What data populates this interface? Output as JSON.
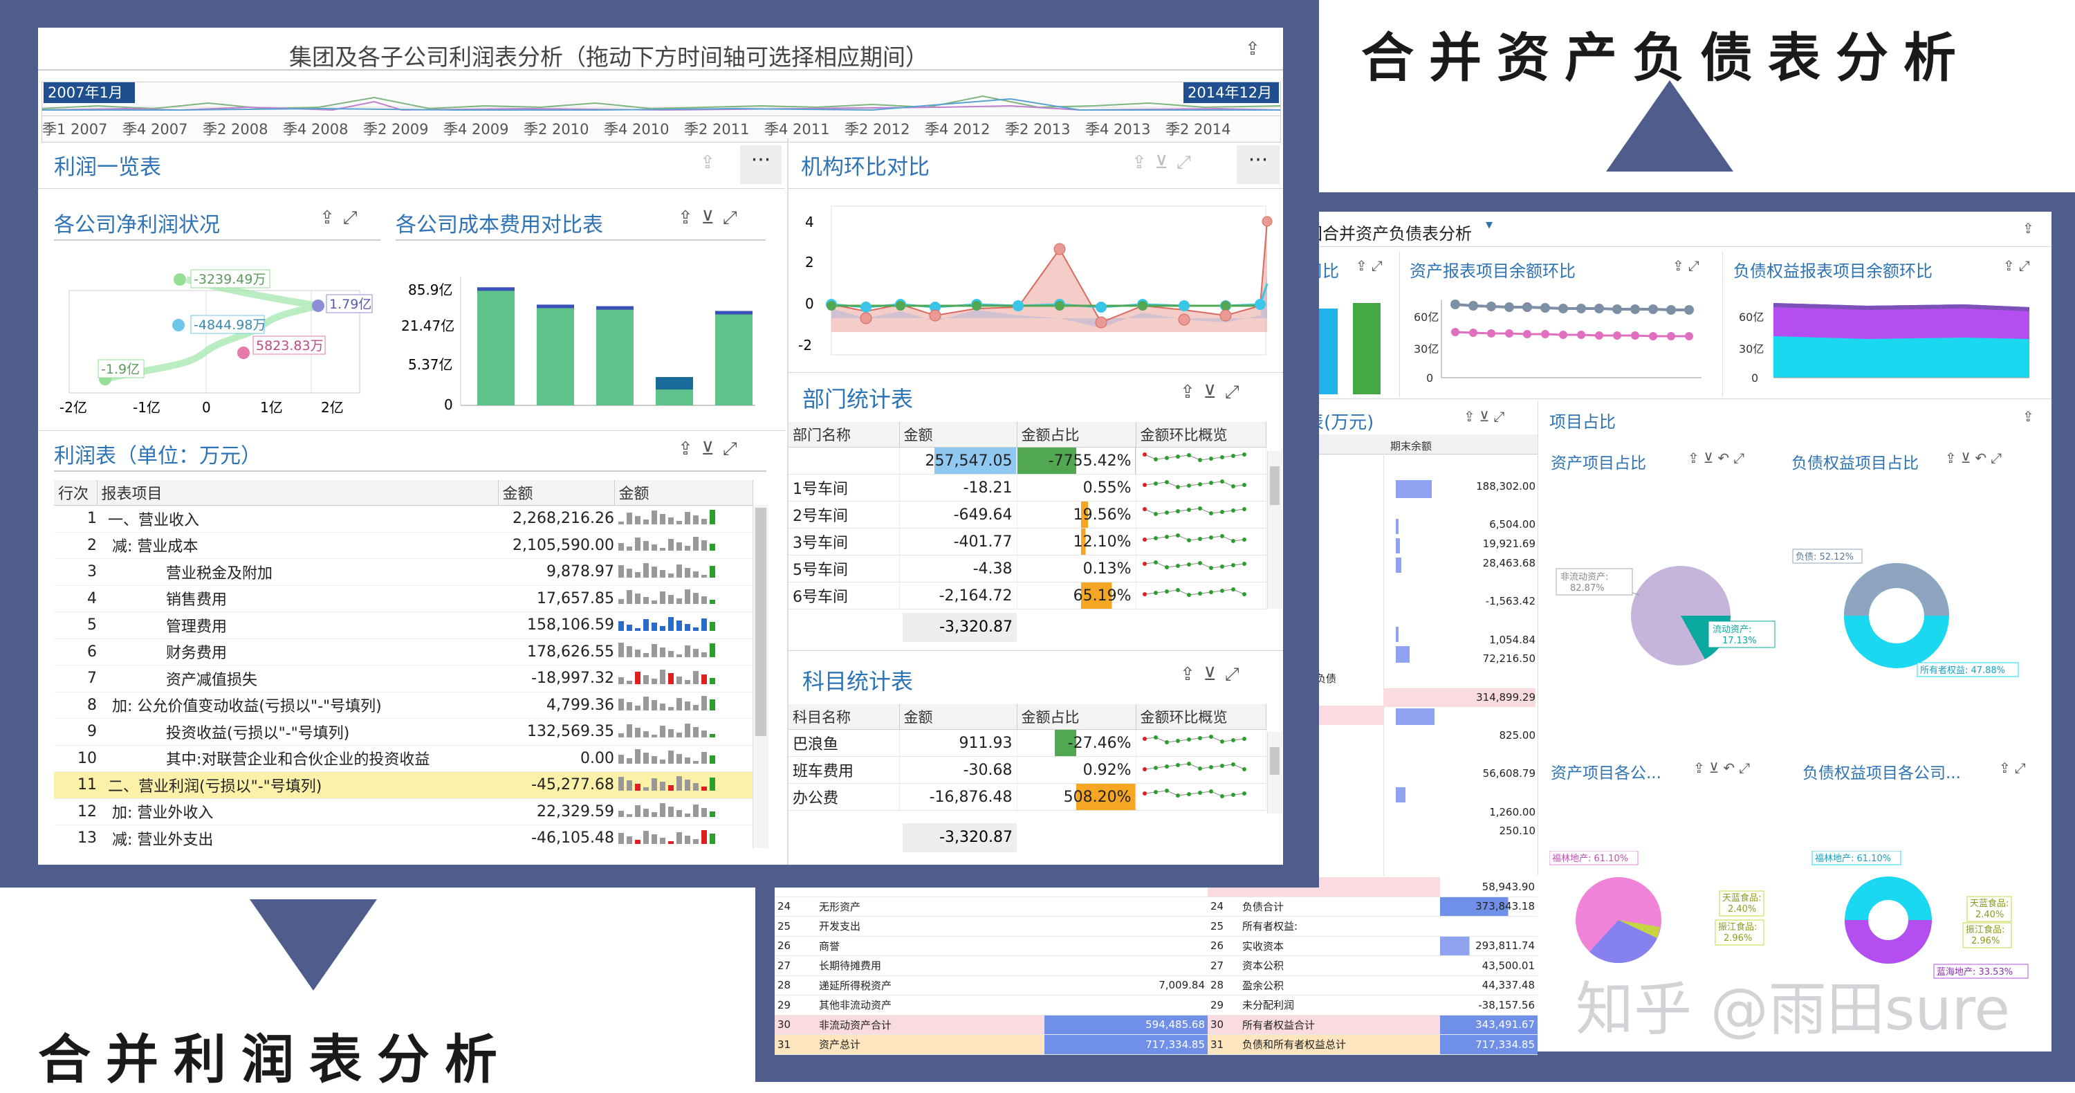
{
  "callouts": {
    "balance_sheet": "合并资产负债表分析",
    "income": "合并利润表分析"
  },
  "watermark": "知乎 @雨田sure",
  "main": {
    "title": "集团及各子公司利润表分析（拖动下方时间轴可选择相应期间）",
    "range_start": "2007年1月",
    "range_end": "2014年12月",
    "timeline_labels": [
      "季1 2007",
      "季4 2007",
      "季2 2008",
      "季4 2008",
      "季2 2009",
      "季4 2009",
      "季2 2010",
      "季4 2010",
      "季2 2011",
      "季4 2011",
      "季2 2012",
      "季4 2012",
      "季2 2013",
      "季4 2013",
      "季2 2014"
    ]
  },
  "profit_overview": {
    "title": "利润一览表"
  },
  "net_profit": {
    "title": "各公司净利润状况",
    "labels": [
      "-3239.49万",
      "1.79亿",
      "-4844.98万",
      "5823.83万",
      "-1.9亿"
    ],
    "x_ticks": [
      "-2亿",
      "-1亿",
      "0",
      "1亿",
      "2亿"
    ]
  },
  "cost_compare": {
    "title": "各公司成本费用对比表",
    "y_ticks": [
      "85.9亿",
      "21.47亿",
      "5.37亿",
      "0"
    ]
  },
  "chart_data": [
    {
      "type": "scatter",
      "title": "各公司净利润状况",
      "series": [
        {
          "values": [
            -19000,
            -4844.98,
            -3239.49,
            5823.83,
            17900
          ]
        }
      ],
      "xlim": [
        -2,
        2
      ],
      "x_ticks": [
        "-2亿",
        "-1亿",
        "0",
        "1亿",
        "2亿"
      ]
    },
    {
      "type": "bar",
      "title": "各公司成本费用对比表",
      "categories": [
        "1",
        "2",
        "3",
        "4",
        "5"
      ],
      "values": [
        75,
        64,
        63,
        18,
        60
      ],
      "y_ticks": [
        "85.9亿",
        "21.47亿",
        "5.37亿",
        "0"
      ]
    },
    {
      "type": "line",
      "title": "机构环比对比",
      "y_ticks": [
        "4",
        "2",
        "0",
        "-2"
      ],
      "ylim": [
        -2.5,
        4.5
      ]
    }
  ],
  "profit_table": {
    "title": "利润表（单位：万元）",
    "headers": [
      "行次",
      "报表项目",
      "金额",
      "金额"
    ],
    "rows": [
      {
        "no": "1",
        "item": "一、营业收入",
        "amount": "2,268,216.26"
      },
      {
        "no": "2",
        "item": "减: 营业成本",
        "amount": "2,105,590.00"
      },
      {
        "no": "3",
        "item": "营业税金及附加",
        "amount": "9,878.97"
      },
      {
        "no": "4",
        "item": "销售费用",
        "amount": "17,657.85"
      },
      {
        "no": "5",
        "item": "管理费用",
        "amount": "158,106.59"
      },
      {
        "no": "6",
        "item": "财务费用",
        "amount": "178,626.55"
      },
      {
        "no": "7",
        "item": "资产减值损失",
        "amount": "-18,997.32"
      },
      {
        "no": "8",
        "item": "加: 公允价值变动收益(亏损以\"-\"号填列)",
        "amount": "4,799.36"
      },
      {
        "no": "9",
        "item": "投资收益(亏损以\"-\"号填列)",
        "amount": "132,569.35"
      },
      {
        "no": "10",
        "item": "其中:对联营企业和合伙企业的投资收益",
        "amount": "0.00"
      },
      {
        "no": "11",
        "item": "二、营业利润(亏损以\"-\"号填列)",
        "amount": "-45,277.68"
      },
      {
        "no": "12",
        "item": "加: 营业外收入",
        "amount": "22,329.59"
      },
      {
        "no": "13",
        "item": "减: 营业外支出",
        "amount": "-46,105.48"
      }
    ]
  },
  "org_compare": {
    "title": "机构环比对比",
    "y_ticks": [
      "4",
      "2",
      "0",
      "-2"
    ]
  },
  "dept_stats": {
    "title": "部门统计表",
    "headers": [
      "部门名称",
      "金额",
      "金额占比",
      "金额环比概览"
    ],
    "rows": [
      {
        "name": "",
        "amount": "257,547.05",
        "ratio": "-7755.42%"
      },
      {
        "name": "1号车间",
        "amount": "-18.21",
        "ratio": "0.55%"
      },
      {
        "name": "2号车间",
        "amount": "-649.64",
        "ratio": "19.56%"
      },
      {
        "name": "3号车间",
        "amount": "-401.77",
        "ratio": "12.10%"
      },
      {
        "name": "5号车间",
        "amount": "-4.38",
        "ratio": "0.13%"
      },
      {
        "name": "6号车间",
        "amount": "-2,164.72",
        "ratio": "65.19%"
      }
    ],
    "total": "-3,320.87"
  },
  "subject_stats": {
    "title": "科目统计表",
    "headers": [
      "科目名称",
      "金额",
      "金额占比",
      "金额环比概览"
    ],
    "rows": [
      {
        "name": "巴浪鱼",
        "amount": "911.93",
        "ratio": "-27.46%"
      },
      {
        "name": "班车费用",
        "amount": "-30.68",
        "ratio": "0.92%"
      },
      {
        "name": "办公费",
        "amount": "-16,876.48",
        "ratio": "508.20%"
      }
    ],
    "total": "-3,320.87"
  },
  "bs": {
    "title": "团合并资产负债表分析",
    "p1_title": "司比",
    "p2_title": "资产报表项目余额环比",
    "p3_title": "负债权益报表项目余额环比",
    "p2_ticks": [
      "60亿",
      "30亿",
      "0"
    ],
    "p3_ticks": [
      "60亿",
      "30亿",
      "0"
    ],
    "table_title": "表(万元)",
    "col_header": "期末余额",
    "right_values": [
      "188,302.00",
      "",
      "6,504.00",
      "19,921.69",
      "28,463.68",
      "",
      "-1,563.42",
      "",
      "1,054.84",
      "72,216.50",
      "",
      "314,899.29",
      "",
      "825.00",
      "",
      "56,608.79",
      "",
      "1,260.00",
      "250.10"
    ],
    "fuzhai": "负债",
    "share_title": "项目占比",
    "asset_share": "资产项目占比",
    "liab_share": "负债权益项目占比",
    "asset_by_co": "资产项目各公...",
    "liab_by_co": "负债权益项目各公司...",
    "pie1_l1": "非流动资产:\n82.87%",
    "pie1_l2": "流动资产:\n17.13%",
    "donut1_l1": "负债: 52.12%",
    "donut1_l2": "所有者权益: 47.88%",
    "pie2_l1": "福林地产: 61.10%",
    "pie2_l2": "天蓝食品:\n2.40%",
    "pie2_l3": "振江食品:\n2.96%",
    "pie2_l4": "蓝海地产: 33.53%",
    "bottom_rows": [
      {
        "l_no": "",
        "l_item": "",
        "l_val": "",
        "r_no": "",
        "r_item": "",
        "r_val": "58,943.90"
      },
      {
        "l_no": "24",
        "l_item": "无形资产",
        "l_val": "",
        "r_no": "24",
        "r_item": "负债合计",
        "r_val": "373,843.18"
      },
      {
        "l_no": "25",
        "l_item": "开发支出",
        "l_val": "",
        "r_no": "25",
        "r_item": "所有者权益:",
        "r_val": ""
      },
      {
        "l_no": "26",
        "l_item": "商誉",
        "l_val": "",
        "r_no": "26",
        "r_item": "实收资本",
        "r_val": "293,811.74"
      },
      {
        "l_no": "27",
        "l_item": "长期待摊费用",
        "l_val": "",
        "r_no": "27",
        "r_item": "资本公积",
        "r_val": "43,500.01"
      },
      {
        "l_no": "28",
        "l_item": "递延所得税资产",
        "l_val": "7,009.84",
        "r_no": "28",
        "r_item": "盈余公积",
        "r_val": "44,337.48"
      },
      {
        "l_no": "29",
        "l_item": "其他非流动资产",
        "l_val": "",
        "r_no": "29",
        "r_item": "未分配利润",
        "r_val": "-38,157.56"
      },
      {
        "l_no": "30",
        "l_item": "非流动资产合计",
        "l_val": "594,485.68",
        "r_no": "30",
        "r_item": "所有者权益合计",
        "r_val": "343,491.67"
      },
      {
        "l_no": "31",
        "l_item": "资产总计",
        "l_val": "717,334.85",
        "r_no": "31",
        "r_item": "负债和所有者权益总计",
        "r_val": "717,334.85"
      }
    ]
  }
}
